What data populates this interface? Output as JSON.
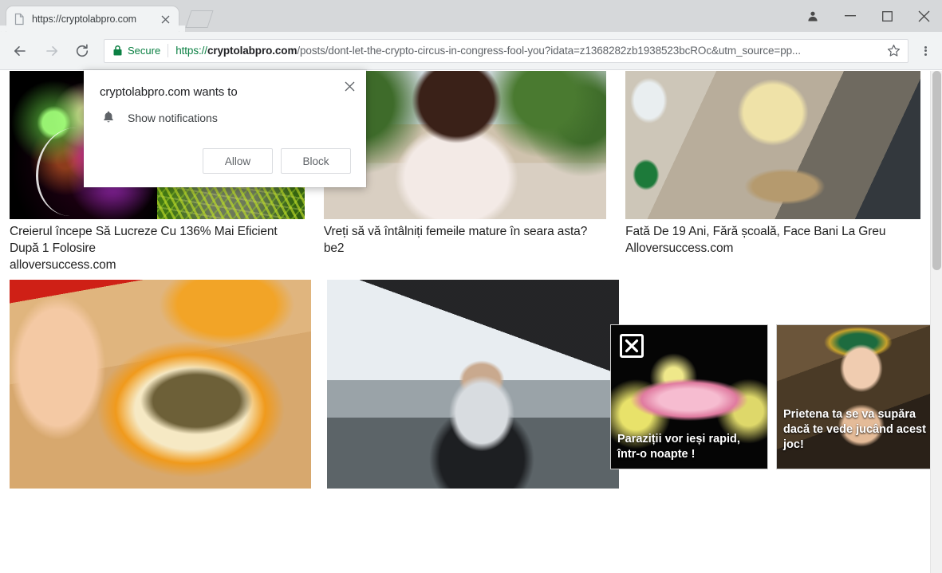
{
  "browser": {
    "tab": {
      "title": "https://cryptolabpro.com",
      "favicon_icon": "page-icon",
      "close_icon": "close-icon"
    },
    "new_tab_icon": "new-tab-icon",
    "window_controls": {
      "profile_icon": "profile-avatar-icon",
      "minimize_icon": "minimize-icon",
      "maximize_icon": "maximize-icon",
      "close_icon": "window-close-icon"
    },
    "toolbar": {
      "back_icon": "back-arrow-icon",
      "forward_icon": "forward-arrow-icon",
      "reload_icon": "reload-icon",
      "lock_icon": "padlock-icon",
      "secure_label": "Secure",
      "secure_color": "#0b8043",
      "url_scheme": "https://",
      "url_host": "cryptolabpro.com",
      "url_path": "/posts/dont-let-the-crypto-circus-in-congress-fool-you?idata=z1368282zb1938523bcROc&utm_source=pp...",
      "star_icon": "bookmark-star-icon",
      "menu_icon": "three-dot-menu-icon"
    }
  },
  "permission_dialog": {
    "title": "cryptolabpro.com wants to",
    "permission_icon": "bell-icon",
    "permission_label": "Show notifications",
    "allow_label": "Allow",
    "block_label": "Block",
    "close_icon": "dialog-close-icon"
  },
  "ads": {
    "row1": [
      {
        "title": "Creierul începe Să Lucreze Cu 136% Mai Eficient După 1 Folosire",
        "source": "alloversuccess.com",
        "image_name": "brain-gears-seaweed-image"
      },
      {
        "title": "Vreți să vă întâlniți femeile mature în seara asta?",
        "source": "be2",
        "image_name": "woman-floral-dress-image"
      },
      {
        "title": "Fată De 19 Ani, Fără școală, Face Bani La Greu",
        "source": "Alloversuccess.com",
        "image_name": "blonde-woman-dog-plane-image"
      }
    ],
    "row2": [
      {
        "image_name": "papaya-seeds-spoon-image"
      },
      {
        "image_name": "man-suit-sports-car-image"
      }
    ],
    "banners": [
      {
        "caption": "Paraziții vor ieși rapid, într-o noapte !",
        "image_name": "parasite-tongue-image",
        "close_icon": "banner-close-icon"
      },
      {
        "caption": "Prietena ta se va supăra dacă te vede jucând acest joc!",
        "image_name": "egyptian-queen-game-image"
      }
    ]
  },
  "scrollbar": {
    "name": "page-scrollbar"
  }
}
